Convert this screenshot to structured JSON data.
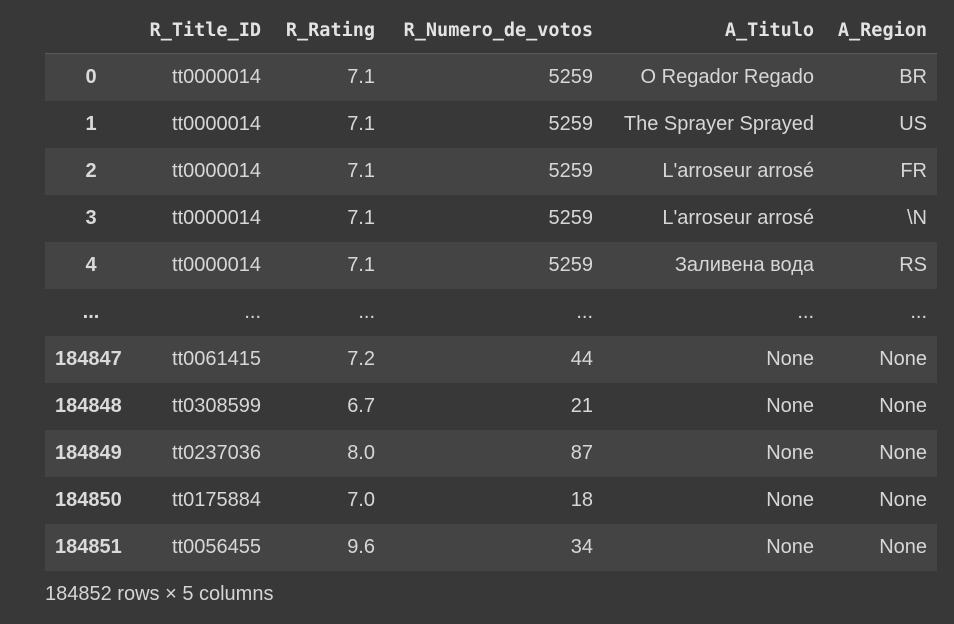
{
  "dataframe": {
    "columns": [
      "",
      "R_Title_ID",
      "R_Rating",
      "R_Numero_de_votos",
      "A_Titulo",
      "A_Region"
    ],
    "rows": [
      {
        "index": "0",
        "R_Title_ID": "tt0000014",
        "R_Rating": "7.1",
        "R_Numero_de_votos": "5259",
        "A_Titulo": "O Regador Regado",
        "A_Region": "BR"
      },
      {
        "index": "1",
        "R_Title_ID": "tt0000014",
        "R_Rating": "7.1",
        "R_Numero_de_votos": "5259",
        "A_Titulo": "The Sprayer Sprayed",
        "A_Region": "US"
      },
      {
        "index": "2",
        "R_Title_ID": "tt0000014",
        "R_Rating": "7.1",
        "R_Numero_de_votos": "5259",
        "A_Titulo": "L'arroseur arrosé",
        "A_Region": "FR"
      },
      {
        "index": "3",
        "R_Title_ID": "tt0000014",
        "R_Rating": "7.1",
        "R_Numero_de_votos": "5259",
        "A_Titulo": "L'arroseur arrosé",
        "A_Region": "\\N"
      },
      {
        "index": "4",
        "R_Title_ID": "tt0000014",
        "R_Rating": "7.1",
        "R_Numero_de_votos": "5259",
        "A_Titulo": "Заливена вода",
        "A_Region": "RS"
      },
      {
        "index": "...",
        "R_Title_ID": "...",
        "R_Rating": "...",
        "R_Numero_de_votos": "...",
        "A_Titulo": "...",
        "A_Region": "..."
      },
      {
        "index": "184847",
        "R_Title_ID": "tt0061415",
        "R_Rating": "7.2",
        "R_Numero_de_votos": "44",
        "A_Titulo": "None",
        "A_Region": "None"
      },
      {
        "index": "184848",
        "R_Title_ID": "tt0308599",
        "R_Rating": "6.7",
        "R_Numero_de_votos": "21",
        "A_Titulo": "None",
        "A_Region": "None"
      },
      {
        "index": "184849",
        "R_Title_ID": "tt0237036",
        "R_Rating": "8.0",
        "R_Numero_de_votos": "87",
        "A_Titulo": "None",
        "A_Region": "None"
      },
      {
        "index": "184850",
        "R_Title_ID": "tt0175884",
        "R_Rating": "7.0",
        "R_Numero_de_votos": "18",
        "A_Titulo": "None",
        "A_Region": "None"
      },
      {
        "index": "184851",
        "R_Title_ID": "tt0056455",
        "R_Rating": "9.6",
        "R_Numero_de_votos": "34",
        "A_Titulo": "None",
        "A_Region": "None"
      }
    ],
    "footer": "184852 rows × 5 columns"
  },
  "colors": {
    "background": "#383838",
    "row_alt": "#444444",
    "text": "#d5d5d5"
  }
}
